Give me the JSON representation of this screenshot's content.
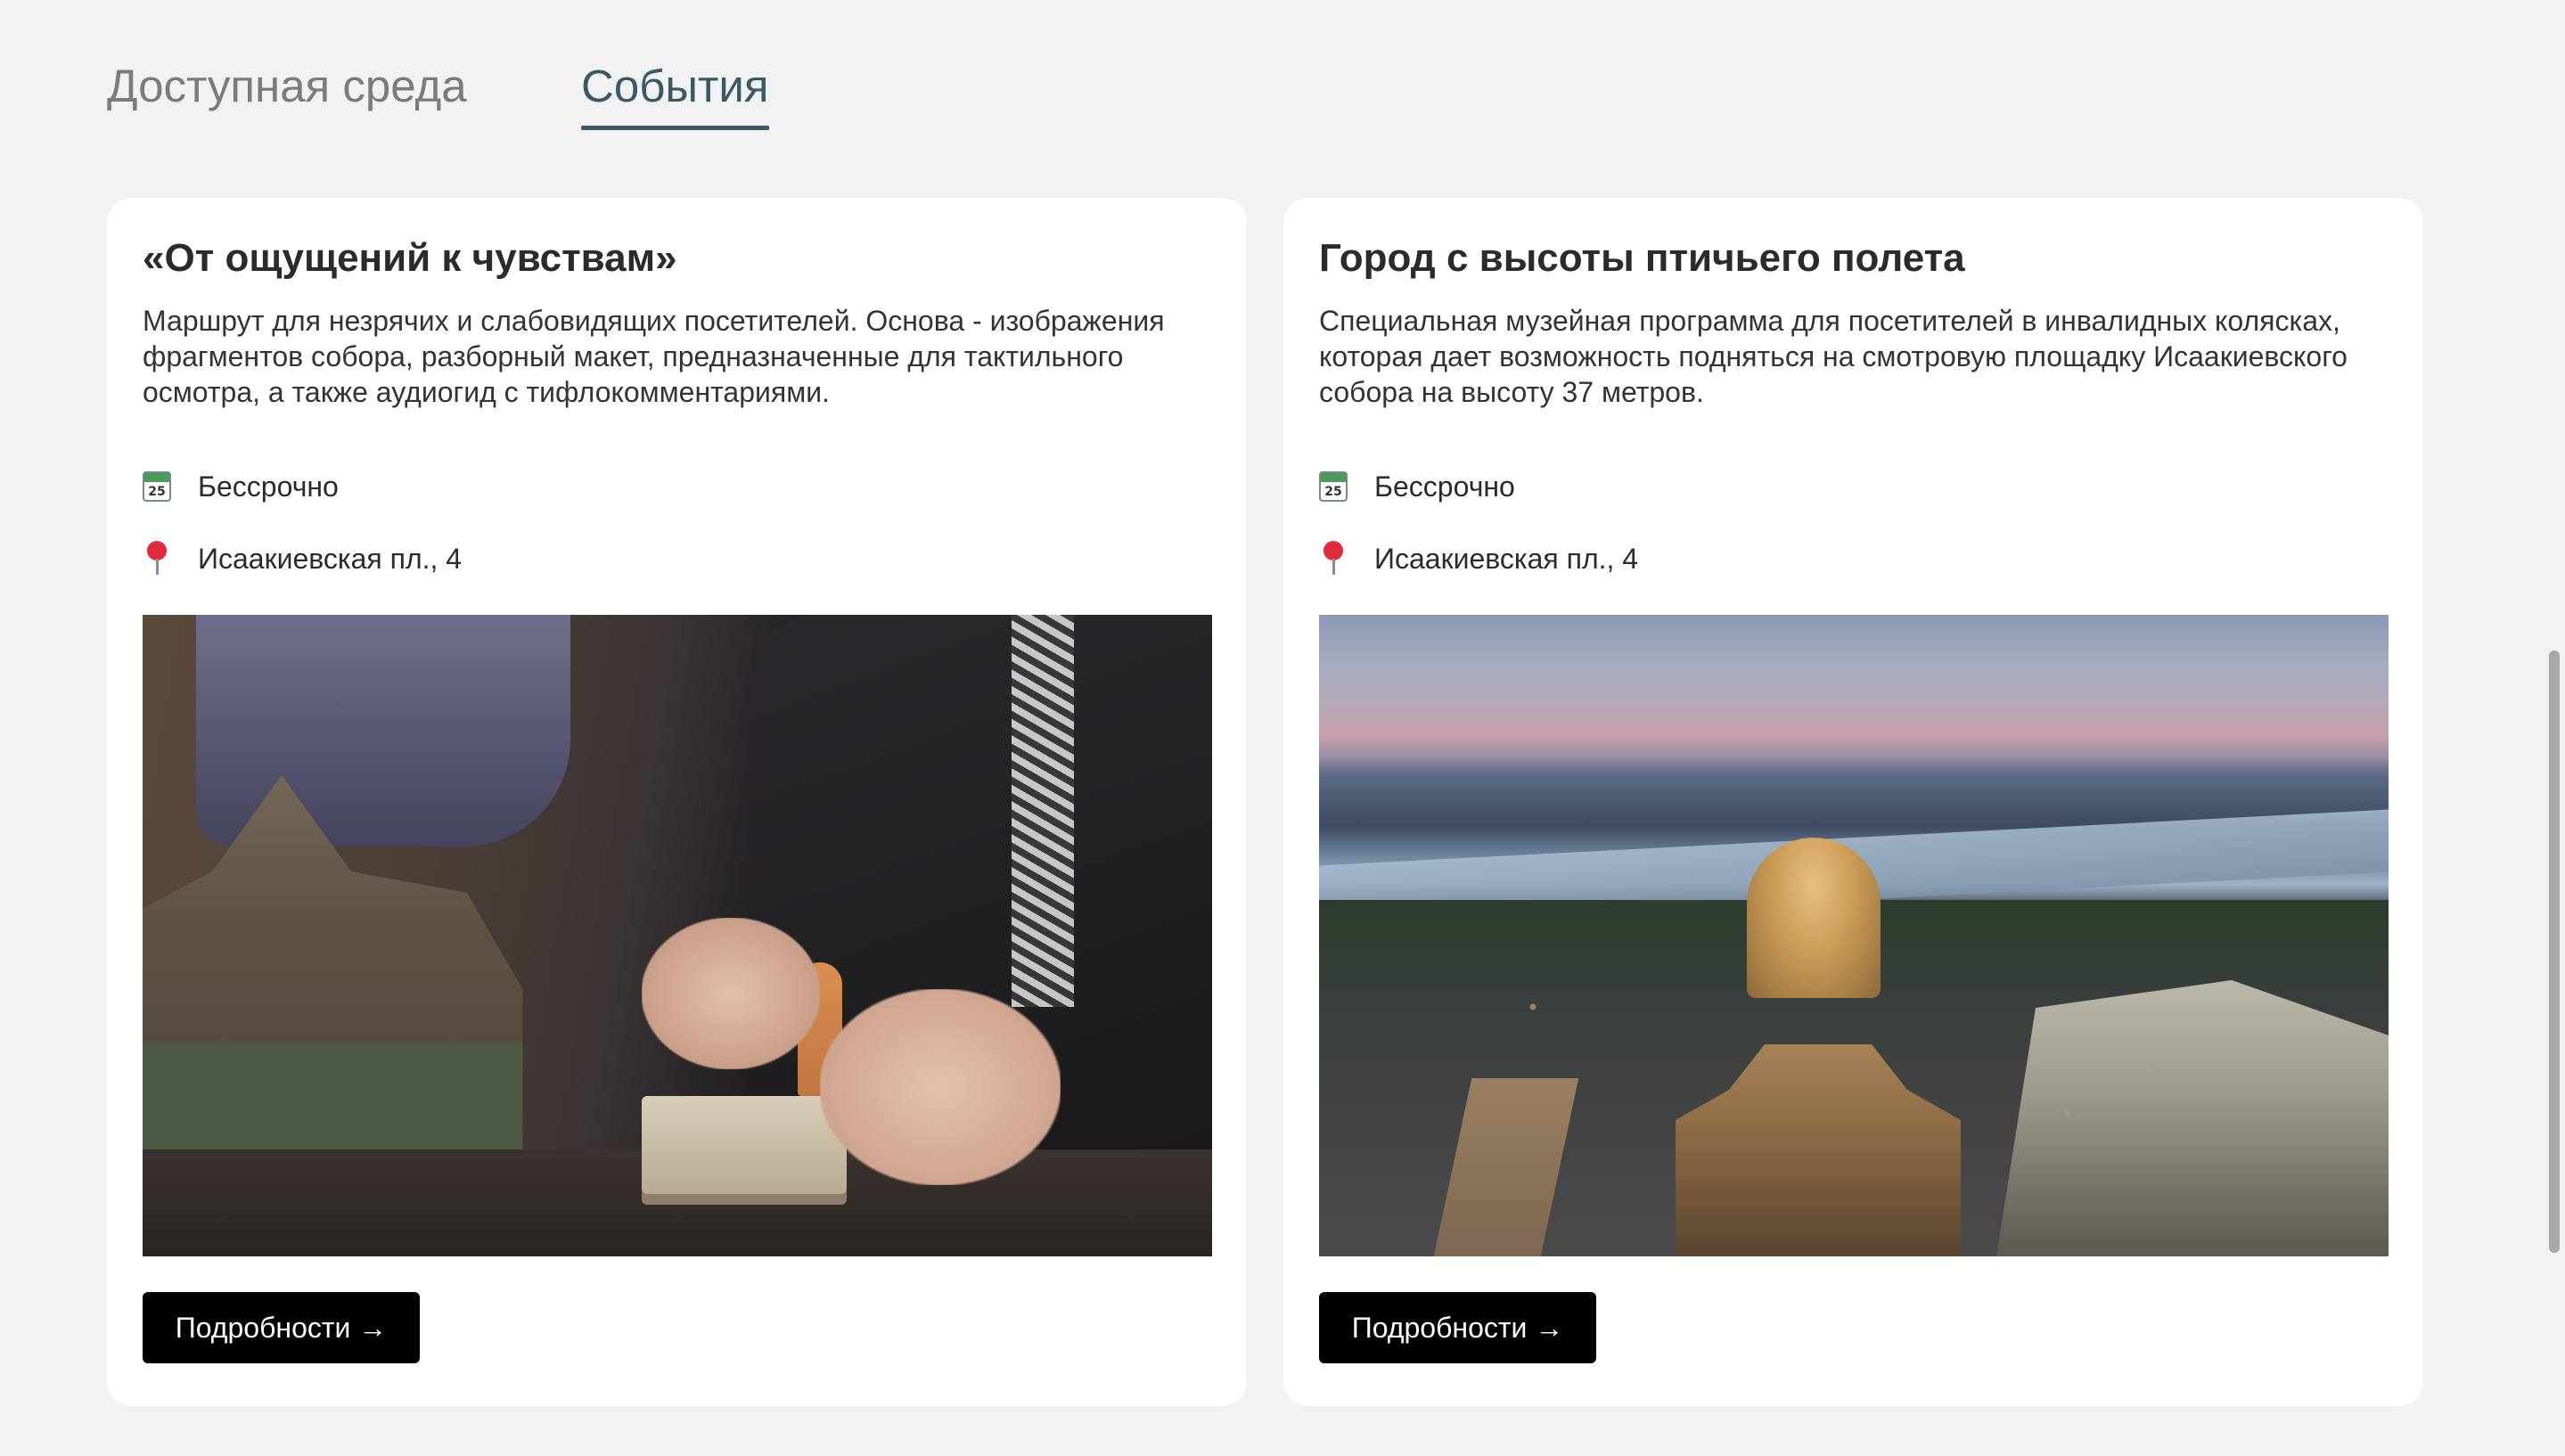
{
  "tabs": [
    {
      "label": "Доступная среда",
      "active": false
    },
    {
      "label": "События",
      "active": true
    }
  ],
  "accent_color": "#3a5965",
  "cards": [
    {
      "title": "«От ощущений к чувствам»",
      "description": "Маршрут для незрячих и слабовидящих посетителей. Основа - изображения фрагментов собора, разборный макет, предназначенные для тактильного осмотра, а также аудиогид с тифлокомментариями.",
      "date_icon": "calendar-icon",
      "calendar_day": "25",
      "date": "Бессрочно",
      "place_icon": "pin-icon",
      "place": "Исаакиевская пл., 4",
      "button_label": "Подробности →"
    },
    {
      "title": "Город с высоты птичьего полета",
      "description": "Специальная музейная программа для посетителей в инвалидных колясках, которая дает возможность подняться на смотровую площадку Исаакиевского собора на высоту 37 метров.",
      "date_icon": "calendar-icon",
      "calendar_day": "25",
      "date": "Бессрочно",
      "place_icon": "pin-icon",
      "place": "Исаакиевская пл., 4",
      "button_label": "Подробности →"
    }
  ]
}
